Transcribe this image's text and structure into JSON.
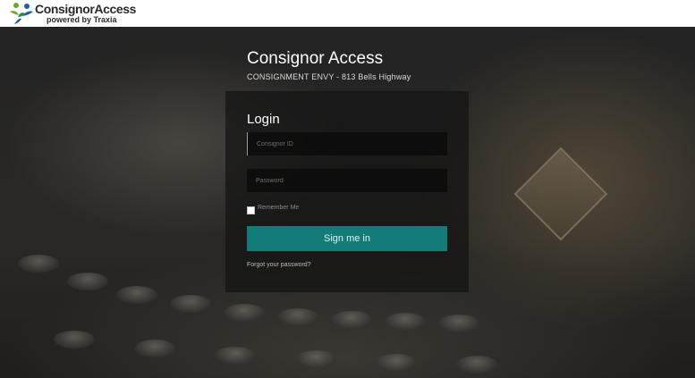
{
  "header": {
    "logo_name": "ConsignorAccess",
    "logo_tagline": "powered by Traxia"
  },
  "brand": {
    "title": "Consignor Access",
    "location": "CONSIGNMENT ENVY - 813 Bells Highway"
  },
  "login": {
    "title": "Login",
    "consignor_id_placeholder": "Consignor ID",
    "consignor_id_value": "",
    "password_placeholder": "Password",
    "password_value": "",
    "remember_label": "Remember Me",
    "remember_checked": false,
    "signin_label": "Sign me in",
    "forgot_label": "Forgot your password?"
  },
  "colors": {
    "button": "#137c78",
    "logo_green": "#6aaa2a",
    "logo_blue": "#1f5fa8"
  }
}
